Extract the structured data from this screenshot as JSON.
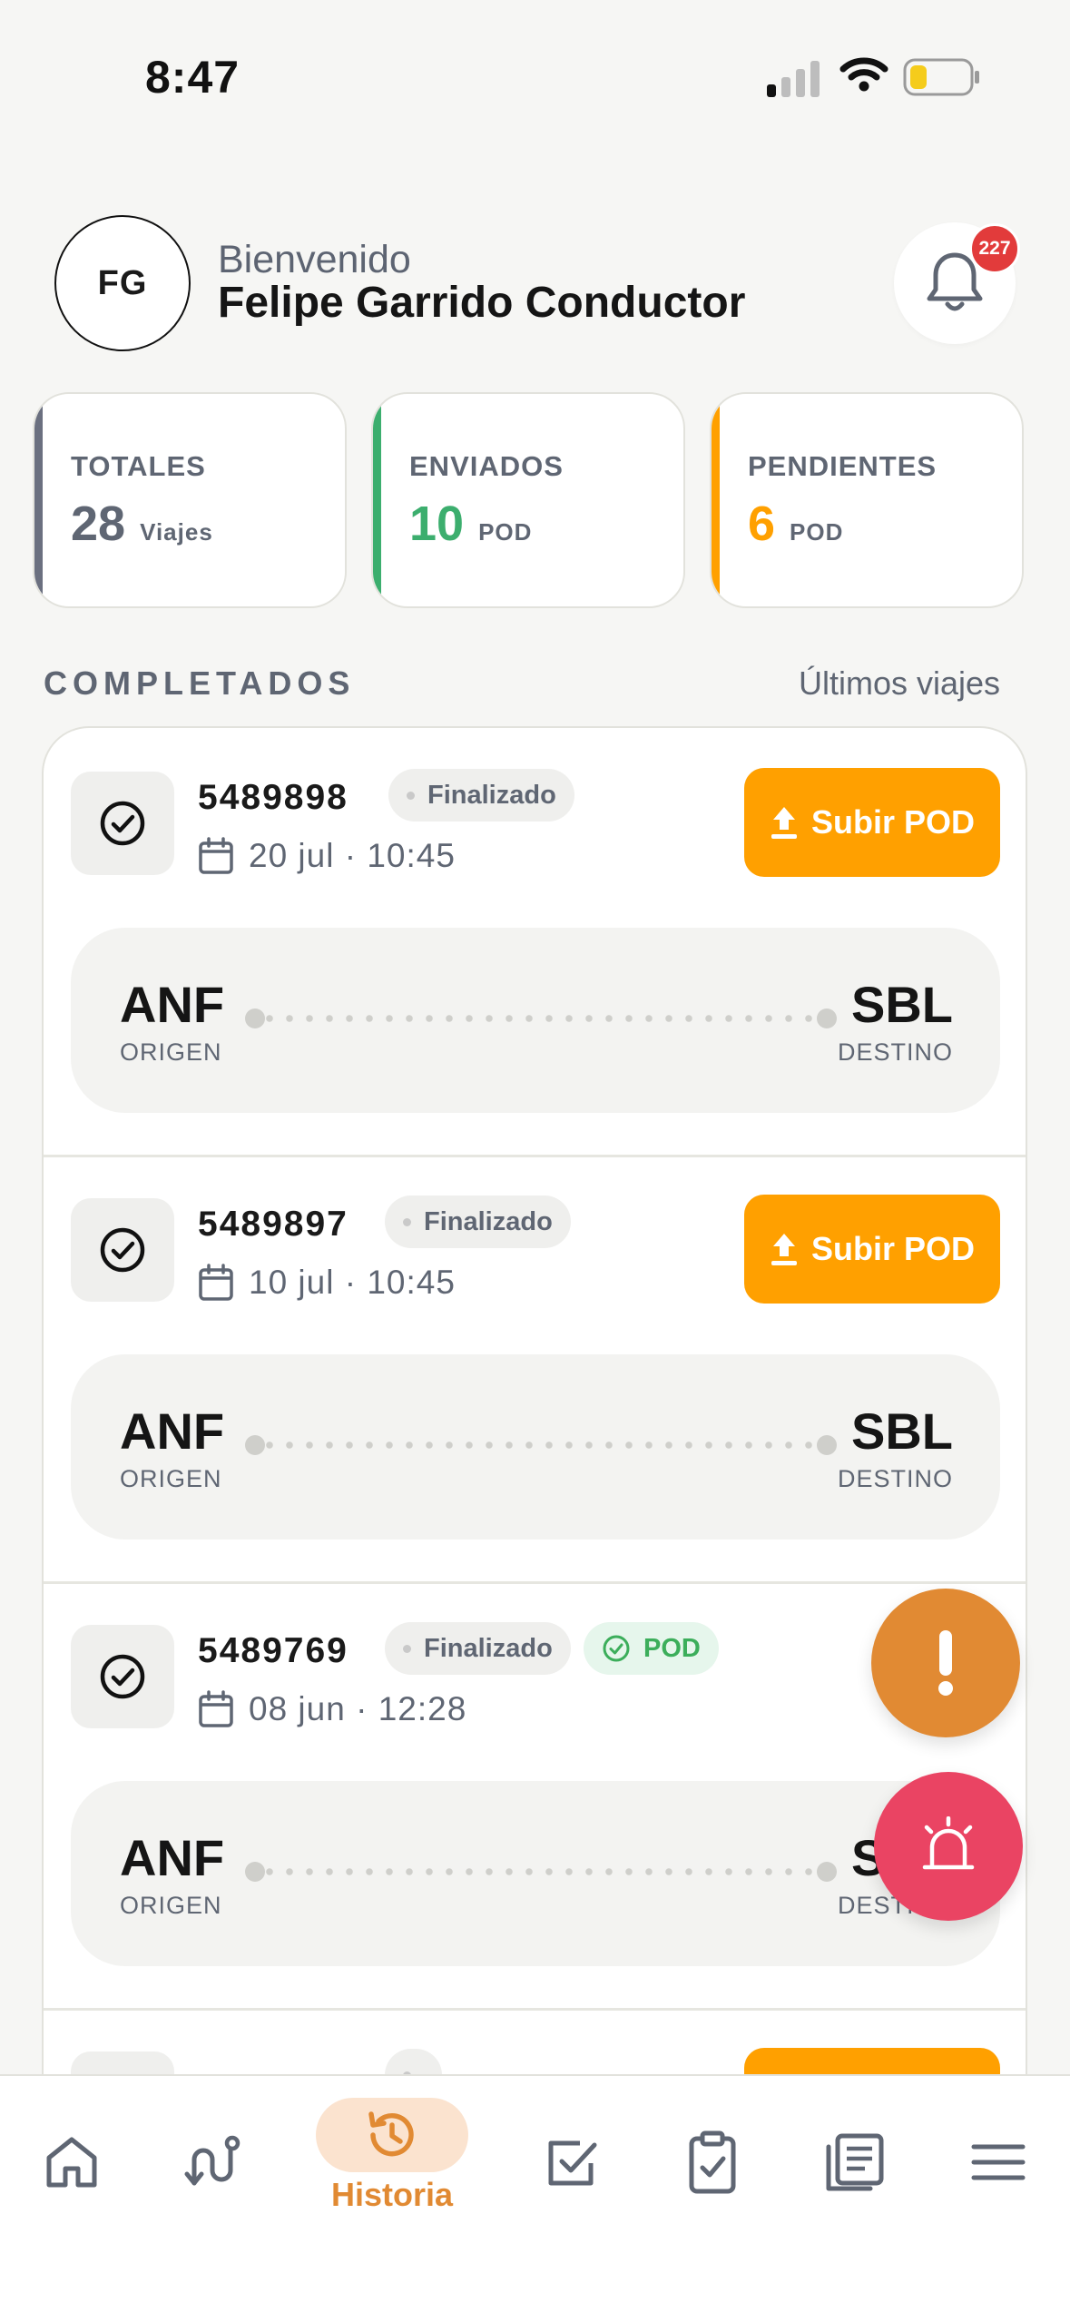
{
  "status_bar": {
    "time": "8:47"
  },
  "header": {
    "avatar_initials": "FG",
    "welcome": "Bienvenido",
    "user_name": "Felipe Garrido Conductor",
    "notification_count": "227"
  },
  "stats": [
    {
      "label": "TOTALES",
      "value": "28",
      "unit": "Viajes",
      "color": "#6b7080"
    },
    {
      "label": "ENVIADOS",
      "value": "10",
      "unit": "POD",
      "color": "#3cae6e"
    },
    {
      "label": "PENDIENTES",
      "value": "6",
      "unit": "POD",
      "color": "#ffa000"
    }
  ],
  "section": {
    "title": "COMPLETADOS",
    "link": "Últimos viajes"
  },
  "trips": [
    {
      "id": "5489898",
      "status": "Finalizado",
      "date": "20 jul · 10:45",
      "action": "Subir POD",
      "origin": "ANF",
      "origin_label": "ORIGEN",
      "destination": "SBL",
      "destination_label": "DESTINO"
    },
    {
      "id": "5489897",
      "status": "Finalizado",
      "date": "10 jul · 10:45",
      "action": "Subir POD",
      "origin": "ANF",
      "origin_label": "ORIGEN",
      "destination": "SBL",
      "destination_label": "DESTINO"
    },
    {
      "id": "5489769",
      "status": "Finalizado",
      "pod_badge": "POD",
      "date": "08 jun · 12:28",
      "origin": "ANF",
      "origin_label": "ORIGEN",
      "destination": "SBL",
      "destination_label": "DESTINO"
    }
  ],
  "nav": {
    "items": [
      "home-icon",
      "route-icon",
      "history-icon",
      "checkbox-icon",
      "clipboard-icon",
      "news-icon",
      "menu-icon"
    ],
    "active_label": "Historia"
  },
  "colors": {
    "accent": "#ffa000",
    "active_nav": "#e18a33",
    "alert_fab": "#e18a33",
    "siren_fab": "#ea4463"
  }
}
